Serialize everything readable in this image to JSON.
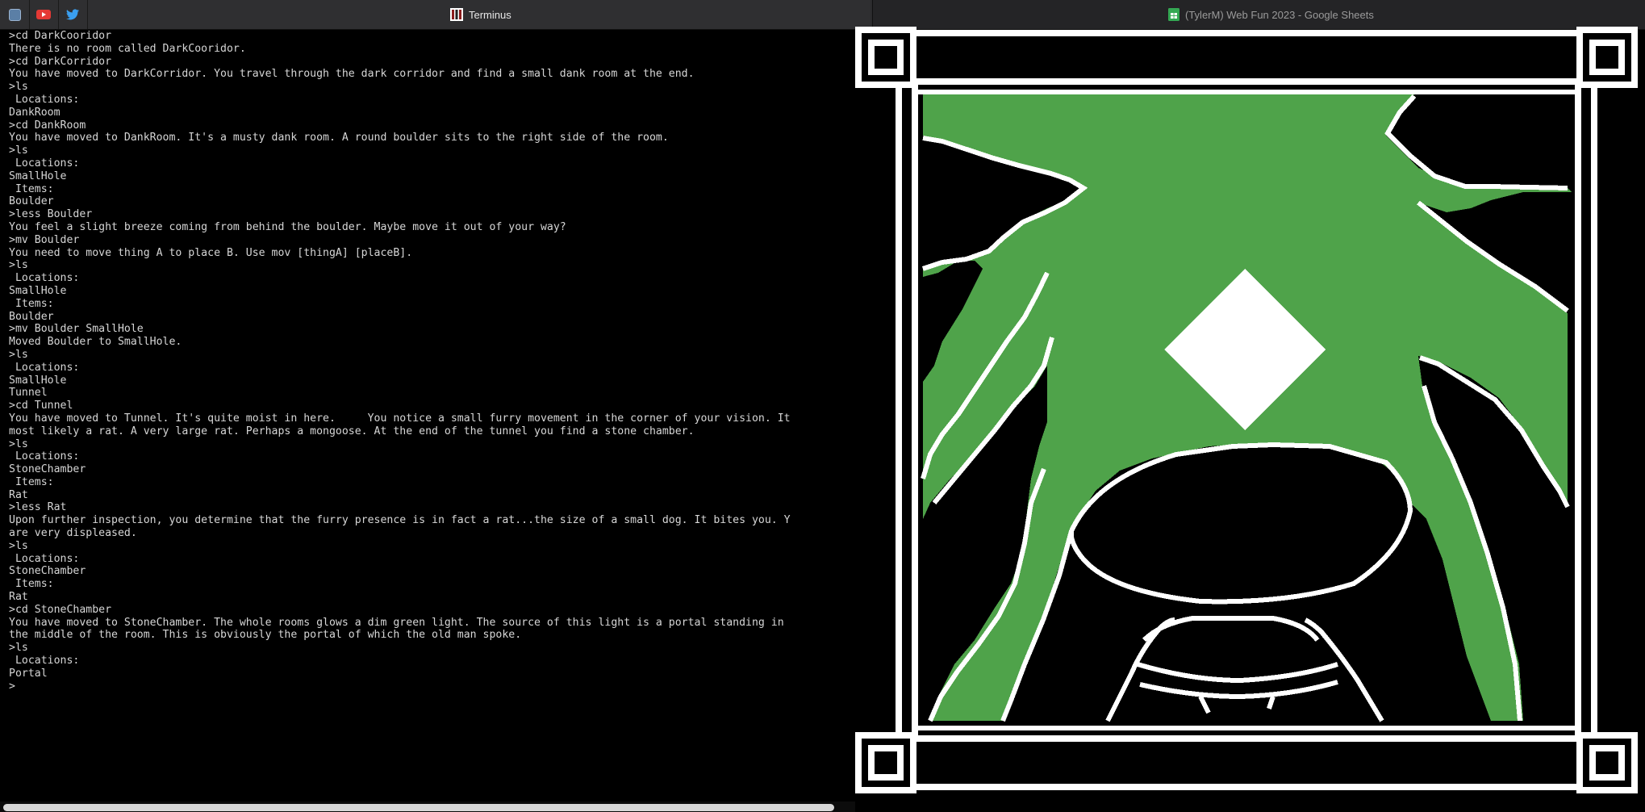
{
  "tabs": {
    "pinned": [
      {
        "icon": "pinned-app-icon",
        "color": "#5b7fa6"
      },
      {
        "icon": "youtube-icon",
        "color": "#e53935"
      },
      {
        "icon": "twitter-icon",
        "color": "#3a9ff0"
      }
    ],
    "active_title": "Terminus",
    "inactive_title": "(TylerM) Web Fun 2023 - Google Sheets"
  },
  "terminal": {
    "lines": [
      ">cd DarkCooridor",
      "There is no room called DarkCooridor.",
      ">cd DarkCorridor",
      "You have moved to DarkCorridor. You travel through the dark corridor and find a small dank room at the end.",
      ">ls",
      " Locations:",
      "DankRoom",
      ">cd DankRoom",
      "You have moved to DankRoom. It's a musty dank room. A round boulder sits to the right side of the room.",
      ">ls",
      " Locations:",
      "SmallHole",
      " Items:",
      "Boulder",
      ">less Boulder",
      "You feel a slight breeze coming from behind the boulder. Maybe move it out of your way?",
      ">mv Boulder",
      "You need to move thing A to place B. Use mov [thingA] [placeB].",
      ">ls",
      " Locations:",
      "SmallHole",
      " Items:",
      "Boulder",
      ">mv Boulder SmallHole",
      "Moved Boulder to SmallHole.",
      ">ls",
      " Locations:",
      "SmallHole",
      "Tunnel",
      ">cd Tunnel",
      "You have moved to Tunnel. It's quite moist in here.     You notice a small furry movement in the corner of your vision. It",
      "most likely a rat. A very large rat. Perhaps a mongoose. At the end of the tunnel you find a stone chamber.",
      ">ls",
      " Locations:",
      "StoneChamber",
      " Items:",
      "Rat",
      ">less Rat",
      "Upon further inspection, you determine that the furry presence is in fact a rat...the size of a small dog. It bites you. Y",
      "are very displeased.",
      ">ls",
      " Locations:",
      "StoneChamber",
      " Items:",
      "Rat",
      ">cd StoneChamber",
      "You have moved to StoneChamber. The whole rooms glows a dim green light. The source of this light is a portal standing in",
      "the middle of the room. This is obviously the portal of which the old man spoke.",
      ">ls",
      " Locations:",
      "Portal",
      ">"
    ]
  },
  "art": {
    "colors": {
      "green": "#4fa34a",
      "white": "#ffffff",
      "black": "#000000"
    }
  }
}
